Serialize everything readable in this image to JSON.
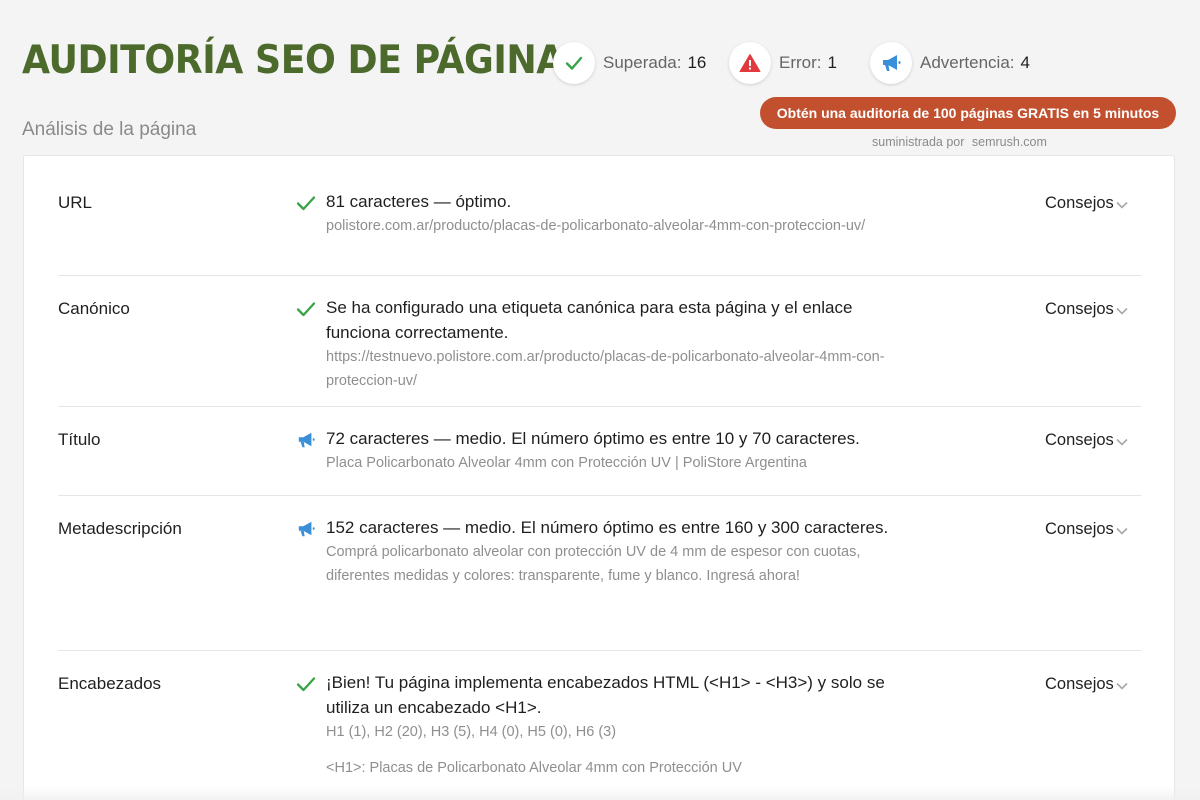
{
  "header": {
    "title": "AUDITORÍA SEO DE PÁGINA",
    "subtitle": "Análisis de la página",
    "stats": [
      {
        "label": "Superada:",
        "count": "16",
        "icon": "check-icon",
        "color": "#3aa347"
      },
      {
        "label": "Error:",
        "count": "1",
        "icon": "warning-icon",
        "color": "#e0393e"
      },
      {
        "label": "Advertencia:",
        "count": "4",
        "icon": "megaphone-icon",
        "color": "#3b8fd9"
      }
    ],
    "cta_label": "Obtén una auditoría de 100 páginas GRATIS en 5 minutos",
    "powered_by": "suministrada por",
    "powered_link": "semrush.com"
  },
  "colors": {
    "title": "#4b6a2c",
    "cta": "#c2502e",
    "pass": "#3aa347",
    "warning": "#3b8fd9",
    "error": "#e0393e"
  },
  "rows": [
    {
      "label": "URL",
      "status": "pass",
      "icon": "check-icon",
      "main": "81 caracteres — óptimo.",
      "detail": "polistore.com.ar/producto/placas-de-policarbonato-alveolar-4mm-con-proteccion-uv/",
      "tips": "Consejos"
    },
    {
      "label": "Canónico",
      "status": "pass",
      "icon": "check-icon",
      "main": "Se ha configurado una etiqueta canónica para esta página y el enlace funciona correctamente.",
      "detail": "https://testnuevo.polistore.com.ar/producto/placas-de-policarbonato-alveolar-4mm-con-proteccion-uv/",
      "tips": "Consejos"
    },
    {
      "label": "Título",
      "status": "warning",
      "icon": "megaphone-icon",
      "main": "72 caracteres — medio. El número óptimo es entre 10 y 70 caracteres.",
      "detail": "Placa Policarbonato Alveolar 4mm con Protección UV | PoliStore Argentina",
      "tips": "Consejos"
    },
    {
      "label": "Metadescripción",
      "status": "warning",
      "icon": "megaphone-icon",
      "main": "152 caracteres — medio. El número óptimo es entre 160 y 300 caracteres.",
      "detail": "Comprá policarbonato alveolar con protección UV de 4 mm de espesor con cuotas, diferentes medidas y colores: transparente, fume y blanco. Ingresá ahora!",
      "tips": "Consejos"
    },
    {
      "label": "Encabezados",
      "status": "pass",
      "icon": "check-icon",
      "main": "¡Bien! Tu página implementa encabezados HTML (<H1> - <H3>) y solo se utiliza un encabezado <H1>.",
      "detail": "H1 (1), H2 (20), H3 (5), H4 (0), H5 (0), H6 (3)",
      "extra": "<H1>: Placas de Policarbonato Alveolar 4mm con Protección UV",
      "tips": "Consejos"
    }
  ]
}
